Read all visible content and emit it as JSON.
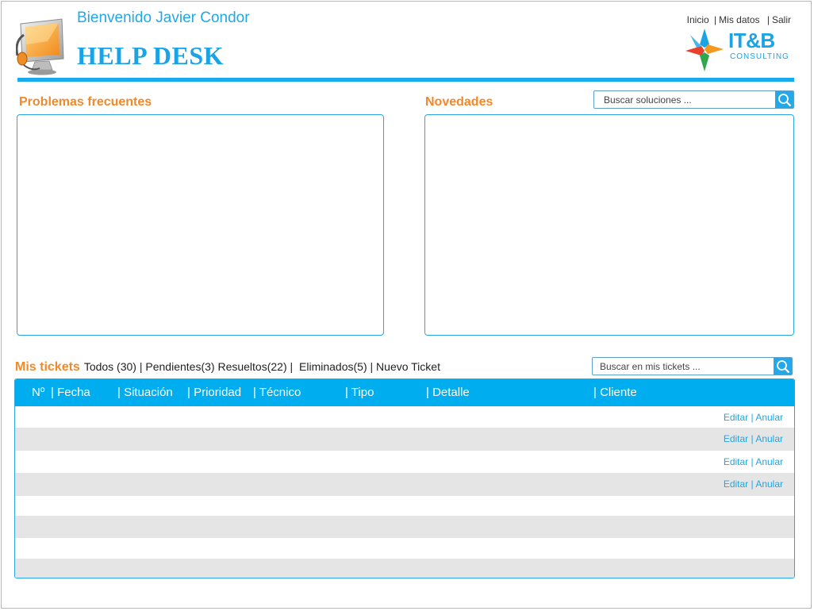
{
  "header": {
    "welcome": "Bienvenido Javier Condor",
    "title": "HELP DESK",
    "nav": {
      "inicio": "Inicio",
      "mis_datos": "Mis datos",
      "salir": "Salir",
      "sep": "|"
    },
    "logo": {
      "name": "IT&B",
      "tagline": "CONSULTING"
    }
  },
  "problemas": {
    "title": "Problemas frecuentes"
  },
  "novedades": {
    "title": "Novedades",
    "search_placeholder": "Buscar soluciones ..."
  },
  "tickets": {
    "title": "Mis tickets",
    "filters": {
      "todos": "Todos (30)",
      "sep1": "|",
      "pendientes": "Pendientes(3)",
      "resueltos": "Resueltos(22)",
      "sep2": "|",
      "eliminados": "Eliminados(5)",
      "sep3": "|",
      "nuevo": "Nuevo Ticket"
    },
    "search_placeholder": "Buscar en mis tickets ...",
    "columns": {
      "numero": "Nº",
      "fecha": "| Fecha",
      "situacion": "| Situación",
      "prioridad": "| Prioridad",
      "tecnico": "| Técnico",
      "tipo": "| Tipo",
      "detalle": "| Detalle",
      "cliente": "| Cliente"
    },
    "actions": {
      "edit": "Editar",
      "sep": "|",
      "cancel": "Anular"
    }
  },
  "colors": {
    "accent_blue": "#00aeef",
    "accent_orange": "#f0892c",
    "row_alt": "#e5e5e5"
  },
  "icons": [
    "monitor-headset-icon",
    "search-icon",
    "itb-logo-icon"
  ]
}
